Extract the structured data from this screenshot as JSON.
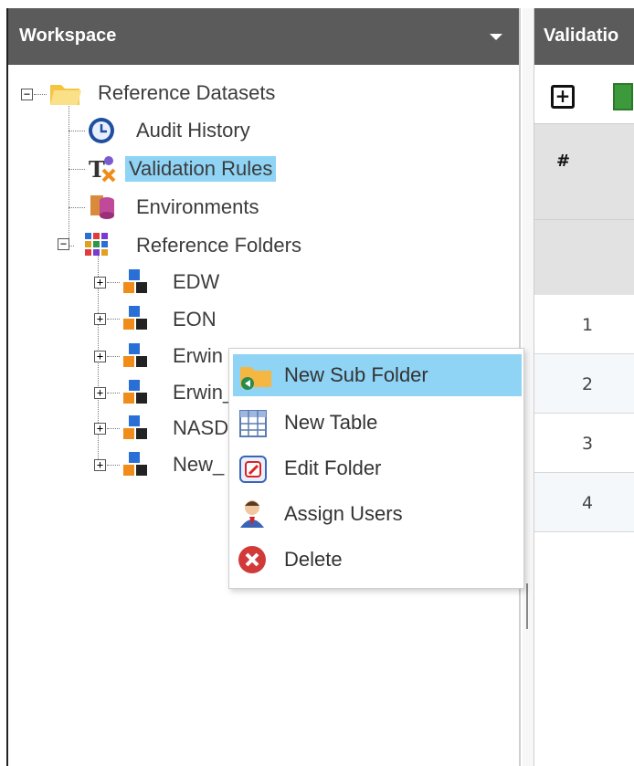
{
  "workspace": {
    "title": "Workspace"
  },
  "validation_panel": {
    "title": "Validatio",
    "grid": {
      "header_hash": "#",
      "row_numbers": [
        "1",
        "2",
        "3",
        "4"
      ]
    }
  },
  "tree": {
    "root": {
      "label": "Reference Datasets",
      "expander": "⊟"
    },
    "items": [
      {
        "label": "Audit History",
        "icon": "clock-icon"
      },
      {
        "label": "Validation Rules",
        "icon": "rules-icon",
        "selected": true
      },
      {
        "label": "Environments",
        "icon": "database-icon"
      },
      {
        "label": "Reference Folders",
        "icon": "grid-folder-icon",
        "expander": "⊟"
      }
    ],
    "folders": [
      {
        "label": "EDW"
      },
      {
        "label": "EON"
      },
      {
        "label": "Erwin"
      },
      {
        "label": "Erwin_"
      },
      {
        "label": "NASD"
      },
      {
        "label": "New_"
      }
    ],
    "selection_color": "#8fd3f5"
  },
  "context_menu": {
    "items": [
      {
        "label": "New Sub Folder",
        "icon": "new-subfolder-icon",
        "highlighted": true
      },
      {
        "label": "New Table",
        "icon": "table-icon"
      },
      {
        "label": "Edit Folder",
        "icon": "edit-icon"
      },
      {
        "label": "Assign Users",
        "icon": "user-icon"
      },
      {
        "label": "Delete",
        "icon": "delete-icon"
      }
    ]
  }
}
